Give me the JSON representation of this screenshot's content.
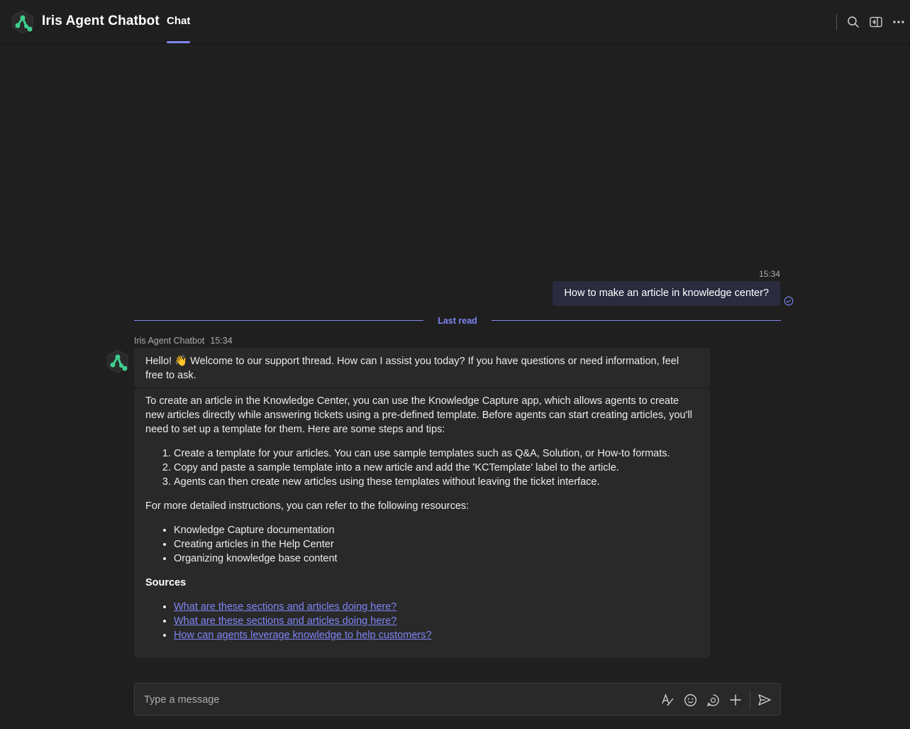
{
  "header": {
    "app_title": "Iris Agent Chatbot",
    "tabs": [
      {
        "label": "Chat",
        "active": true
      }
    ],
    "actions": [
      "search-icon",
      "popout-icon",
      "more-icon"
    ]
  },
  "colors": {
    "accent": "#7f85f5",
    "logo_green": "#3ecf8e",
    "background": "#1f1f1f",
    "bubble_in": "#292929",
    "bubble_out": "#2b2b40"
  },
  "messages": {
    "outgoing": {
      "time": "15:34",
      "text": "How to make an article in knowledge center?"
    },
    "last_read_label": "Last read",
    "incoming": {
      "sender": "Iris Agent Chatbot",
      "time": "15:34",
      "greeting": "Hello! 👋 Welcome to our support thread. How can I assist you today? If you have questions or need information, feel free to ask.",
      "intro": "To create an article in the Knowledge Center, you can use the Knowledge Capture app, which allows agents to create new articles directly while answering tickets using a pre-defined template. Before agents can start creating articles, you'll need to set up a template for them. Here are some steps and tips:",
      "steps": [
        "Create a template for your articles. You can use sample templates such as Q&A, Solution, or How-to formats.",
        "Copy and paste a sample template into a new article and add the 'KCTemplate' label to the article.",
        "Agents can then create new articles using these templates without leaving the ticket interface."
      ],
      "more_text": "For more detailed instructions, you can refer to the following resources:",
      "resources": [
        "Knowledge Capture documentation",
        "Creating articles in the Help Center",
        "Organizing knowledge base content"
      ],
      "sources_heading": "Sources",
      "sources": [
        "What are these sections and articles doing here?",
        "What are these sections and articles doing here?",
        "How can agents leverage knowledge to help customers?"
      ]
    }
  },
  "composer": {
    "placeholder": "Type a message",
    "value": "",
    "actions": [
      "format-icon",
      "emoji-icon",
      "sticker-icon",
      "add-icon",
      "send-icon"
    ]
  }
}
